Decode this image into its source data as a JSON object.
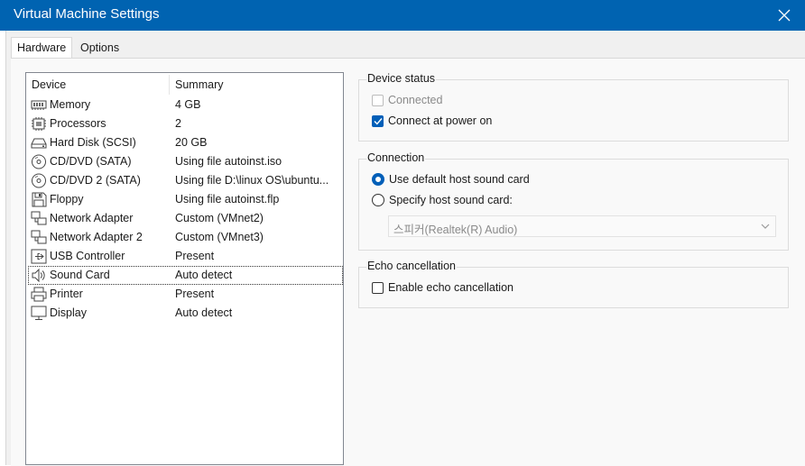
{
  "window": {
    "title": "Virtual Machine Settings"
  },
  "tabs": [
    {
      "label": "Hardware",
      "active": true
    },
    {
      "label": "Options",
      "active": false
    }
  ],
  "device_list": {
    "headers": {
      "device": "Device",
      "summary": "Summary"
    },
    "rows": [
      {
        "icon": "memory-icon",
        "device": "Memory",
        "summary": "4 GB"
      },
      {
        "icon": "processor-icon",
        "device": "Processors",
        "summary": "2"
      },
      {
        "icon": "hard-disk-icon",
        "device": "Hard Disk (SCSI)",
        "summary": "20 GB"
      },
      {
        "icon": "cd-dvd-icon",
        "device": "CD/DVD (SATA)",
        "summary": "Using file autoinst.iso"
      },
      {
        "icon": "cd-dvd-icon",
        "device": "CD/DVD 2 (SATA)",
        "summary": "Using file D:\\linux OS\\ubuntu..."
      },
      {
        "icon": "floppy-icon",
        "device": "Floppy",
        "summary": "Using file autoinst.flp"
      },
      {
        "icon": "network-adapter-icon",
        "device": "Network Adapter",
        "summary": "Custom (VMnet2)"
      },
      {
        "icon": "network-adapter-icon",
        "device": "Network Adapter 2",
        "summary": "Custom (VMnet3)"
      },
      {
        "icon": "usb-controller-icon",
        "device": "USB Controller",
        "summary": "Present"
      },
      {
        "icon": "sound-card-icon",
        "device": "Sound Card",
        "summary": "Auto detect",
        "selected": true
      },
      {
        "icon": "printer-icon",
        "device": "Printer",
        "summary": "Present"
      },
      {
        "icon": "display-icon",
        "device": "Display",
        "summary": "Auto detect"
      }
    ]
  },
  "device_status": {
    "title": "Device status",
    "connected_label": "Connected",
    "connected_checked": false,
    "connect_at_power_on_label": "Connect at power on",
    "connect_at_power_on_checked": true
  },
  "connection": {
    "title": "Connection",
    "use_default_label": "Use default host sound card",
    "specify_label": "Specify host sound card:",
    "selected_option": "use_default",
    "sound_card_value": "스피커(Realtek(R) Audio)"
  },
  "echo_cancellation": {
    "title": "Echo cancellation",
    "enable_label": "Enable echo cancellation",
    "enabled": false
  },
  "colors": {
    "titlebar": "#0063b1",
    "accent": "#005fb8"
  }
}
